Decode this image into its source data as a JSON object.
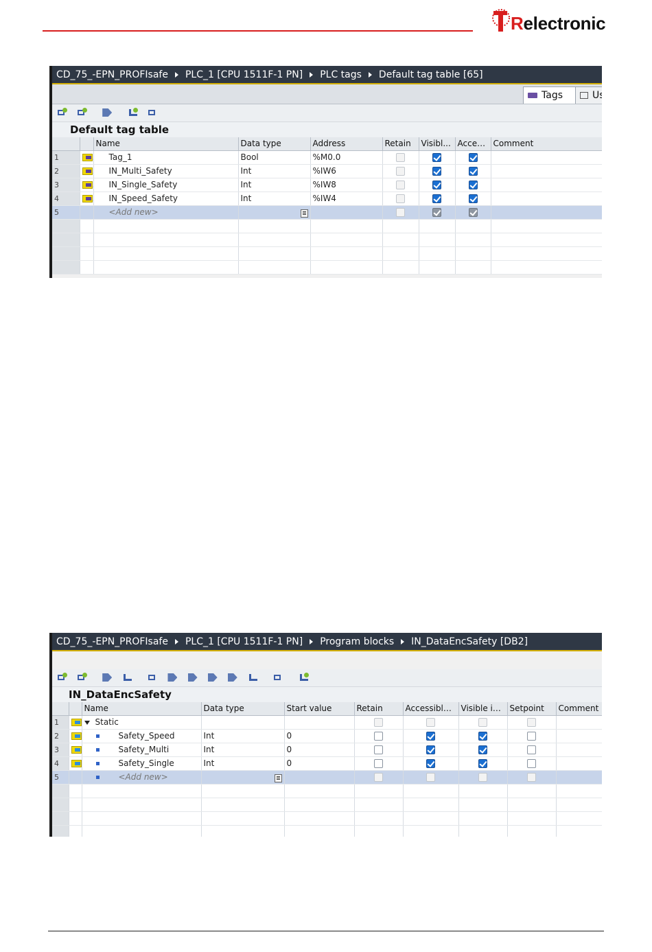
{
  "logo": {
    "brand_prefix": "T",
    "brand_rest": "electronic",
    "brand_r": "R"
  },
  "panel1": {
    "breadcrumb": [
      "CD_75_-EPN_PROFIsafe",
      "PLC_1 [CPU 1511F-1 PN]",
      "PLC tags",
      "Default tag table [65]"
    ],
    "tabs": {
      "tags": "Tags",
      "user": "Us"
    },
    "table_title": "Default tag table",
    "columns": {
      "name": "Name",
      "data_type": "Data type",
      "address": "Address",
      "retain": "Retain",
      "visible": "Visibl...",
      "access": "Acces...",
      "comment": "Comment"
    },
    "rows": [
      {
        "n": "1",
        "name": "Tag_1",
        "type": "Bool",
        "address": "%M0.0",
        "retain": false,
        "visible": true,
        "access": true
      },
      {
        "n": "2",
        "name": "IN_Multi_Safety",
        "type": "Int",
        "address": "%IW6",
        "retain": false,
        "visible": true,
        "access": true
      },
      {
        "n": "3",
        "name": "IN_Single_Safety",
        "type": "Int",
        "address": "%IW8",
        "retain": false,
        "visible": true,
        "access": true
      },
      {
        "n": "4",
        "name": "IN_Speed_Safety",
        "type": "Int",
        "address": "%IW4",
        "retain": false,
        "visible": true,
        "access": true
      }
    ],
    "add_row": {
      "n": "5",
      "label": "<Add new>"
    }
  },
  "panel2": {
    "breadcrumb": [
      "CD_75_-EPN_PROFIsafe",
      "PLC_1 [CPU 1511F-1 PN]",
      "Program blocks",
      "IN_DataEncSafety [DB2]"
    ],
    "table_title": "IN_DataEncSafety",
    "columns": {
      "name": "Name",
      "data_type": "Data type",
      "start": "Start value",
      "retain": "Retain",
      "accessible": "Accessible f...",
      "visible": "Visible in ...",
      "setpoint": "Setpoint",
      "comment": "Comment"
    },
    "group": {
      "n": "1",
      "label": "Static"
    },
    "rows": [
      {
        "n": "2",
        "name": "Safety_Speed",
        "type": "Int",
        "start": "0"
      },
      {
        "n": "3",
        "name": "Safety_Multi",
        "type": "Int",
        "start": "0"
      },
      {
        "n": "4",
        "name": "Safety_Single",
        "type": "Int",
        "start": "0"
      }
    ],
    "add_row": {
      "n": "5",
      "label": "<Add new>"
    }
  },
  "colors": {
    "accent_red": "#d81e1e",
    "breadcrumb_bg": "#2f3845",
    "selection_row": "#c7d4ea",
    "checkbox_on": "#1b6fd1"
  }
}
